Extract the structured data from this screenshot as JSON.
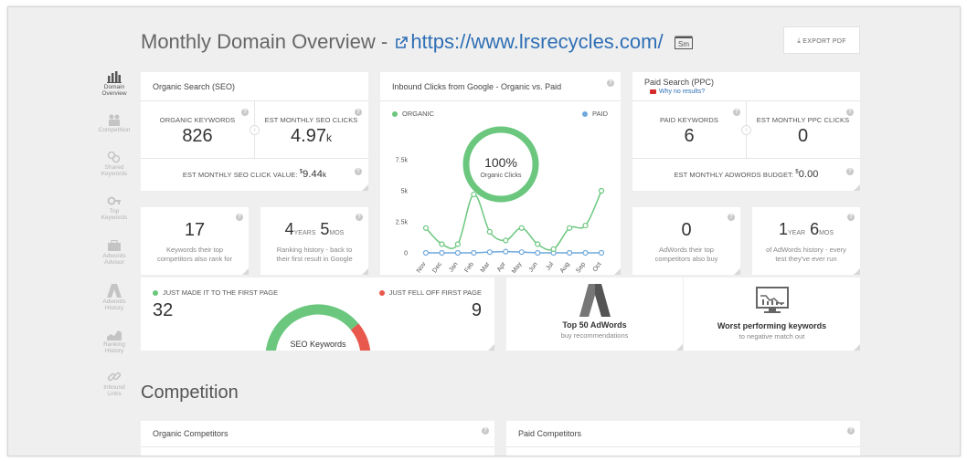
{
  "header": {
    "title_prefix": "Monthly Domain Overview -",
    "url": "https://www.lrsrecycles.com/",
    "sm_badge": "Sm",
    "export_label": "EXPORT PDF"
  },
  "sidebar": {
    "items": [
      {
        "label_1": "Domain",
        "label_2": "Overview"
      },
      {
        "label_1": "Competition",
        "label_2": ""
      },
      {
        "label_1": "Shared",
        "label_2": "Keywords"
      },
      {
        "label_1": "Top",
        "label_2": "Keywords"
      },
      {
        "label_1": "Adwords",
        "label_2": "Advisor"
      },
      {
        "label_1": "Adwords",
        "label_2": "History"
      },
      {
        "label_1": "Ranking",
        "label_2": "History"
      },
      {
        "label_1": "Inbound",
        "label_2": "Links"
      }
    ]
  },
  "seo": {
    "title": "Organic Search (SEO)",
    "keywords_label": "ORGANIC KEYWORDS",
    "keywords_value": "826",
    "clicks_label": "EST MONTHLY SEO CLICKS",
    "clicks_value": "4.97",
    "clicks_unit": "k",
    "click_value_label": "EST MONTHLY SEO CLICK VALUE:",
    "click_value_currency": "$",
    "click_value": "9.44",
    "click_value_unit": "k"
  },
  "clicks_chart": {
    "title": "Inbound Clicks from Google - Organic vs. Paid",
    "organic_label": "ORGANIC",
    "paid_label": "PAID",
    "donut_percent": "100%",
    "donut_label": "Organic Clicks"
  },
  "chart_data": {
    "type": "line",
    "categories": [
      "Nov",
      "Dec",
      "Jan",
      "Feb",
      "Mar",
      "Apr",
      "May",
      "Jun",
      "Jul",
      "Aug",
      "Sep",
      "Oct"
    ],
    "yticks": [
      "0",
      "2.5k",
      "5k",
      "7.5k"
    ],
    "ylim": [
      0,
      7500
    ],
    "series": [
      {
        "name": "ORGANIC",
        "color": "#6bc77e",
        "values": [
          2000,
          700,
          700,
          4700,
          1700,
          1000,
          2000,
          700,
          300,
          2000,
          2200,
          5000
        ]
      },
      {
        "name": "PAID",
        "color": "#6fa8dc",
        "values": [
          0,
          0,
          0,
          0,
          60,
          100,
          60,
          0,
          0,
          0,
          0,
          0
        ]
      }
    ]
  },
  "ppc": {
    "title": "Paid Search (PPC)",
    "why_link": "Why no results?",
    "keywords_label": "PAID KEYWORDS",
    "keywords_value": "6",
    "clicks_label": "EST MONTHLY PPC CLICKS",
    "clicks_value": "0",
    "budget_label": "EST MONTHLY ADWORDS BUDGET:",
    "budget_currency": "$",
    "budget_value": "0.00"
  },
  "competitors_seo": {
    "value": "17",
    "line_1": "Keywords their top",
    "line_2": "competitors also rank for"
  },
  "ranking_history": {
    "years": "4",
    "years_unit": "YEARS",
    "months": "5",
    "months_unit": "MOS",
    "line_1": "Ranking history - back to",
    "line_2": "their first result in Google"
  },
  "competitors_ppc": {
    "value": "0",
    "line_1": "AdWords their top",
    "line_2": "competitors also buy"
  },
  "adwords_history": {
    "years": "1",
    "years_unit": "YEAR",
    "months": "6",
    "months_unit": "MOS",
    "line_1": "of AdWords history - every",
    "line_2": "test they've ever run"
  },
  "first_page": {
    "made_label": "JUST MADE IT TO THE FIRST PAGE",
    "made_value": "32",
    "fell_label": "JUST FELL OFF FIRST PAGE",
    "fell_value": "9",
    "gauge_label": "SEO Keywords",
    "made_fraction": 0.78,
    "made_color": "#6bc77e",
    "fell_color": "#e8584c"
  },
  "top50": {
    "title": "Top 50 AdWords",
    "subtitle": "buy recommendations"
  },
  "worst": {
    "title": "Worst performing keywords",
    "subtitle": "to negative match out"
  },
  "competition": {
    "title": "Competition",
    "organic_title": "Organic Competitors",
    "paid_title": "Paid Competitors"
  }
}
